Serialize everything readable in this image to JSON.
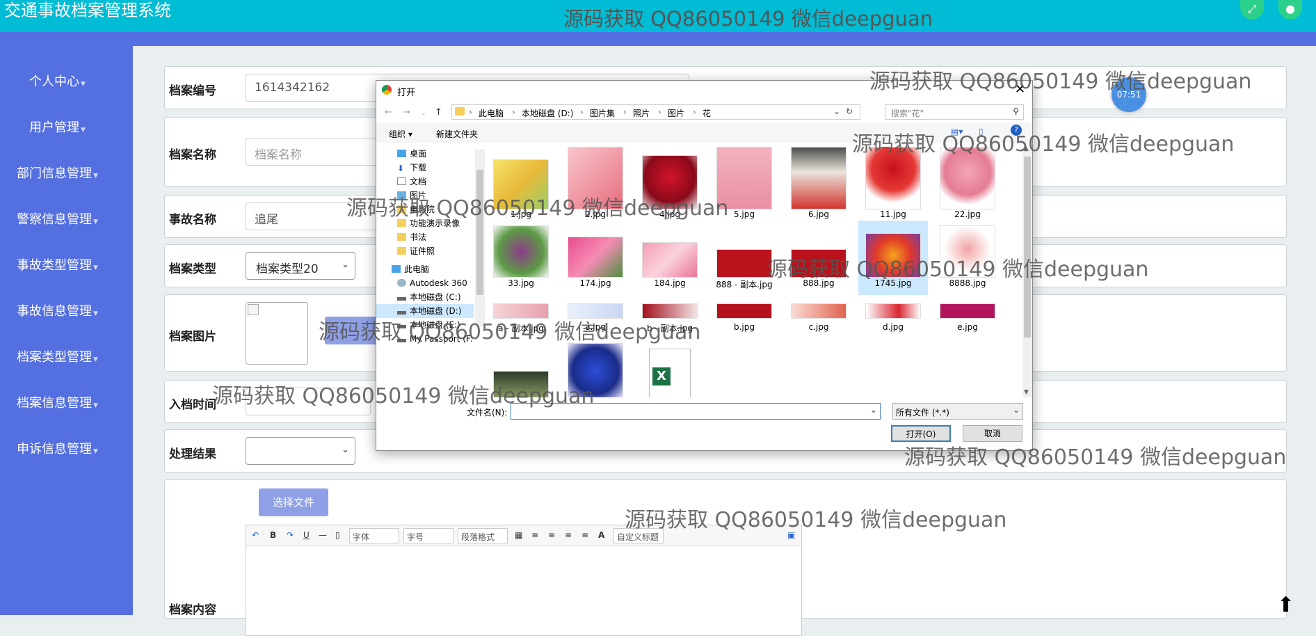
{
  "header": {
    "title": "交通事故档案管理系统",
    "watermark": "源码获取 QQ86050149 微信deepguan",
    "fullscreen_icon": "expand-icon",
    "user_icon": "user-icon"
  },
  "clock": "07:51",
  "sidebar": {
    "items": [
      {
        "label": "个人中心"
      },
      {
        "label": "用户管理"
      },
      {
        "label": "部门信息管理"
      },
      {
        "label": "警察信息管理"
      },
      {
        "label": "事故类型管理"
      },
      {
        "label": "事故信息管理"
      },
      {
        "label": "档案类型管理"
      },
      {
        "label": "档案信息管理"
      },
      {
        "label": "申诉信息管理"
      }
    ]
  },
  "form": {
    "archive_no": {
      "label": "档案编号",
      "value": "1614342162"
    },
    "archive_name": {
      "label": "档案名称",
      "placeholder": "档案名称"
    },
    "accident_name": {
      "label": "事故名称",
      "value": "追尾"
    },
    "archive_type": {
      "label": "档案类型",
      "value": "档案类型20"
    },
    "archive_image": {
      "label": "档案图片"
    },
    "archive_time": {
      "label": "入档时间"
    },
    "result": {
      "label": "处理结果",
      "value": ""
    },
    "content": {
      "label": "档案内容",
      "choose_file": "选择文件"
    }
  },
  "editor": {
    "font": "字体",
    "size": "字号",
    "paragraph": "段落格式",
    "custom_title": "自定义标题"
  },
  "watermarks": [
    "源码获取 QQ86050149 微信deepguan"
  ],
  "dialog": {
    "title": "打开",
    "breadcrumb": [
      "此电脑",
      "本地磁盘 (D:)",
      "图片集",
      "照片",
      "图片",
      "花"
    ],
    "search_placeholder": "搜索\"花\"",
    "organize": "组织 ▾",
    "new_folder": "新建文件夹",
    "nav": [
      "桌面",
      "下载",
      "文档",
      "图片",
      "电影院",
      "功能演示录像",
      "书法",
      "证件照",
      "此电脑",
      "Autodesk 360",
      "本地磁盘 (C:)",
      "本地磁盘 (D:)",
      "本地磁盘 (E:)",
      "My Passport (F:"
    ],
    "files": [
      "1.jpg",
      "2.jpg",
      "4.jpg",
      "5.jpg",
      "6.jpg",
      "11.jpg",
      "22.jpg",
      "33.jpg",
      "174.jpg",
      "184.jpg",
      "888 - 副本.jpg",
      "888.jpg",
      "1745.jpg",
      "8888.jpg",
      "a - 副本.jpg",
      "a.jpg",
      "b - 副本.jpg",
      "b.jpg",
      "c.jpg",
      "d.jpg",
      "e.jpg",
      "",
      "",
      ""
    ],
    "filename_label": "文件名(N):",
    "filetype": "所有文件 (*.*)",
    "open": "打开(O)",
    "cancel": "取消"
  },
  "colors": {
    "topbar": "#00bcd4",
    "sidebar": "#546fe0",
    "upload_btn": "#8fa0e6"
  }
}
